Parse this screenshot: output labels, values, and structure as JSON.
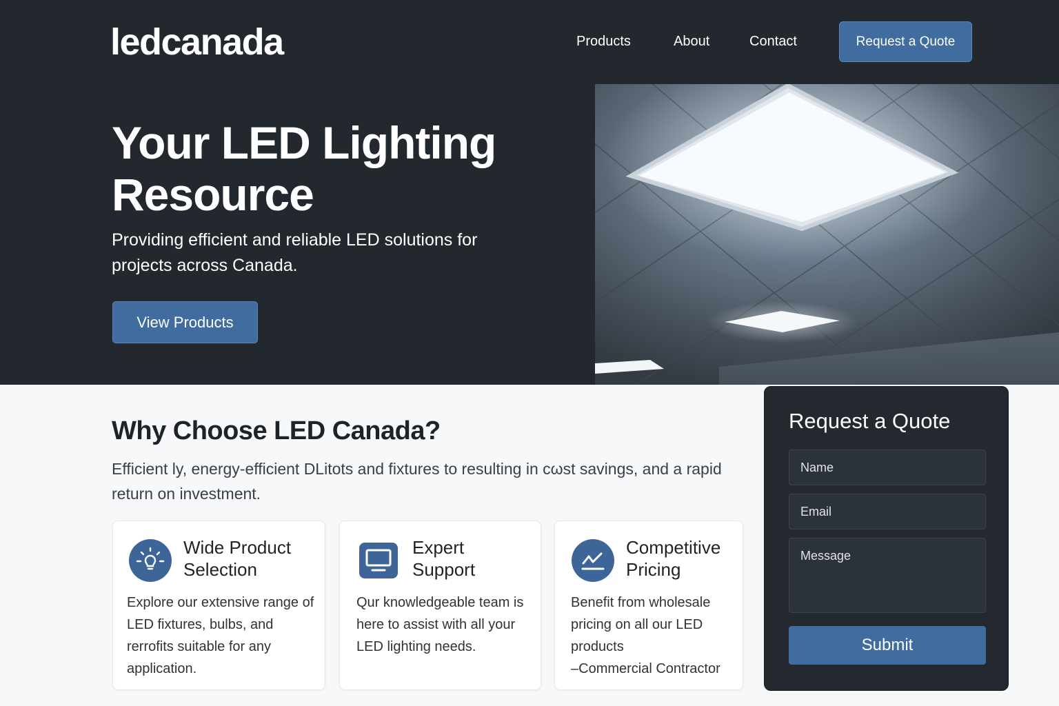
{
  "header": {
    "logo": "ledcanada",
    "nav": [
      {
        "label": "Products"
      },
      {
        "label": "About"
      },
      {
        "label": "Contact"
      }
    ],
    "cta_label": "Request a Quote"
  },
  "hero": {
    "title_line1": "Your LED Lighting",
    "title_line2": "Resource",
    "subtitle": "Providing efficient and reliable LED solutions for projects across Canada.",
    "button_label": "View Products"
  },
  "why": {
    "title": "Why Choose LED Canada?",
    "text": "Efficient ly, energy-efficient DLitots and fixtures to resulting in cωst savings, and a rapid return on investment."
  },
  "features": [
    {
      "icon": "lightbulb-icon",
      "title": "Wide Product Selection",
      "text": "Explore our extensive range of LED fixtures, bulbs, and rerrofits suitable for any application."
    },
    {
      "icon": "monitor-icon",
      "title": "Expert Support",
      "text": "Qur knowledgeable team is here to assist with all your LED lighting needs."
    },
    {
      "icon": "trend-chart-icon",
      "title": "Competitive Pricing",
      "text": "Benefit from wholesale pricing on all our LED products",
      "attribution": "–Commercial Contractor"
    }
  ],
  "quote_form": {
    "title": "Request a Quote",
    "name_placeholder": "Name",
    "email_placeholder": "Email",
    "message_placeholder": "Message",
    "submit_label": "Submit"
  },
  "colors": {
    "hero_bg": "#23282e",
    "accent": "#406c9f",
    "form_bg": "#24292f",
    "page_bg": "#f7f8f9"
  }
}
